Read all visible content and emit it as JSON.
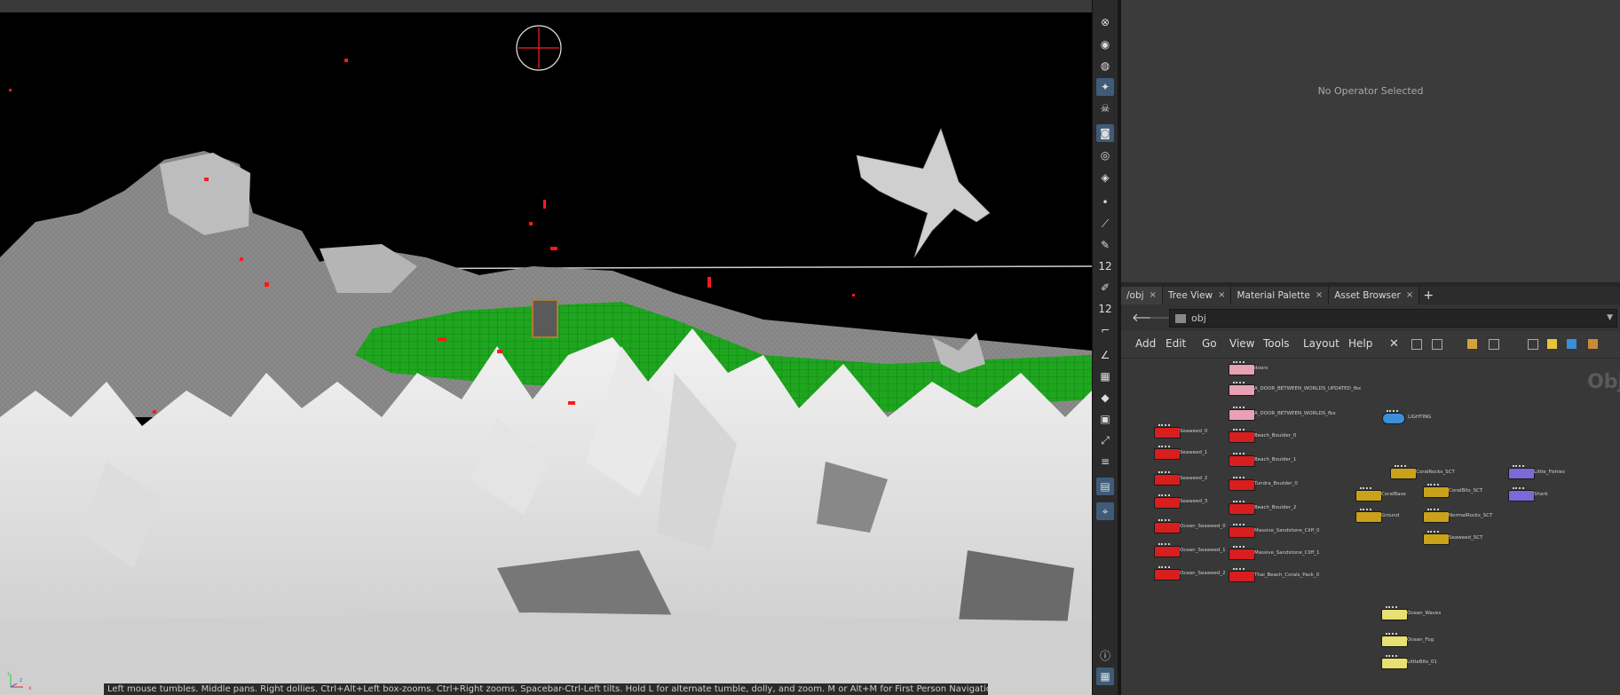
{
  "parameters": {
    "empty_message": "No Operator Selected"
  },
  "tabs": [
    {
      "label": "/obj"
    },
    {
      "label": "Tree View"
    },
    {
      "label": "Material Palette"
    },
    {
      "label": "Asset Browser"
    }
  ],
  "tab_close": "×",
  "tab_add": "+",
  "path": {
    "value": "obj",
    "back": "🡐",
    "forward": "🡒"
  },
  "menus": [
    "Add",
    "Edit",
    "Go",
    "View",
    "Tools",
    "Layout",
    "Help"
  ],
  "network": {
    "title": "Obje",
    "nodes": [
      {
        "label": "doors",
        "color": "#e8a0b4"
      },
      {
        "label": "A_DOOR_BETWEEN_WORLDS_UPDATED_fbx",
        "color": "#e8a0b4"
      },
      {
        "label": "A_DOOR_BETWEEN_WORLDS_fbx",
        "color": "#e8a0b4"
      },
      {
        "label": "LIGHTING",
        "color": "#3a8fd8"
      },
      {
        "label": "Seaweed_0",
        "color": "#d81e1e"
      },
      {
        "label": "Beach_Boulder_0",
        "color": "#d81e1e"
      },
      {
        "label": "Seaweed_1",
        "color": "#d81e1e"
      },
      {
        "label": "Beach_Boulder_1",
        "color": "#d81e1e"
      },
      {
        "label": "Seaweed_2",
        "color": "#d81e1e"
      },
      {
        "label": "Tundra_Boulder_0",
        "color": "#d81e1e"
      },
      {
        "label": "Seaweed_3",
        "color": "#d81e1e"
      },
      {
        "label": "Beach_Boulder_2",
        "color": "#d81e1e"
      },
      {
        "label": "Ocean_Seaweed_0",
        "color": "#d81e1e"
      },
      {
        "label": "Massive_Sandstone_Cliff_0",
        "color": "#d81e1e"
      },
      {
        "label": "Ocean_Seaweed_1",
        "color": "#d81e1e"
      },
      {
        "label": "Massive_Sandstone_Cliff_1",
        "color": "#d81e1e"
      },
      {
        "label": "Ocean_Seaweed_2",
        "color": "#d81e1e"
      },
      {
        "label": "Thai_Beach_Corals_Pack_0",
        "color": "#d81e1e"
      },
      {
        "label": "CoralRocks_SCT",
        "color": "#c9a21a"
      },
      {
        "label": "CoralBase",
        "color": "#c9a21a"
      },
      {
        "label": "CoralBits_SCT",
        "color": "#c9a21a"
      },
      {
        "label": "Ground",
        "color": "#c9a21a"
      },
      {
        "label": "NormalRocks_SCT",
        "color": "#c9a21a"
      },
      {
        "label": "Seaweed_SCT",
        "color": "#c9a21a"
      },
      {
        "label": "Little_Fishies",
        "color": "#7a6ad8"
      },
      {
        "label": "Shark",
        "color": "#7a6ad8"
      },
      {
        "label": "Ocean_Waves",
        "color": "#e8e070"
      },
      {
        "label": "Ocean_Fog",
        "color": "#e8e070"
      },
      {
        "label": "LittleBits_01",
        "color": "#e8e070"
      }
    ]
  },
  "status": "Left mouse tumbles. Middle pans. Right dollies. Ctrl+Alt+Left box-zooms. Ctrl+Right zooms. Spacebar-Ctrl-Left tilts. Hold L for alternate tumble, dolly, and zoom.    M or Alt+M for First Person Navigation.",
  "axes": {
    "y": "y",
    "x": "x",
    "z": "z"
  },
  "tools": [
    "close-icon",
    "sphere-icon",
    "camera-icon",
    "light-icon",
    "skull-icon",
    "render-camera-icon",
    "eye-icon",
    "snapshot-icon",
    "dot-icon",
    "brush-icon",
    "pen-icon",
    "grid-12-icon",
    "edit-icon",
    "grid-22-icon",
    "ruler-icon",
    "measure-icon",
    "checker-icon",
    "diamond-icon",
    "cube-icon",
    "scale-icon",
    "list-icon",
    "display-icon",
    "pin-icon"
  ],
  "colors": {
    "accent": "#3f5b78"
  }
}
